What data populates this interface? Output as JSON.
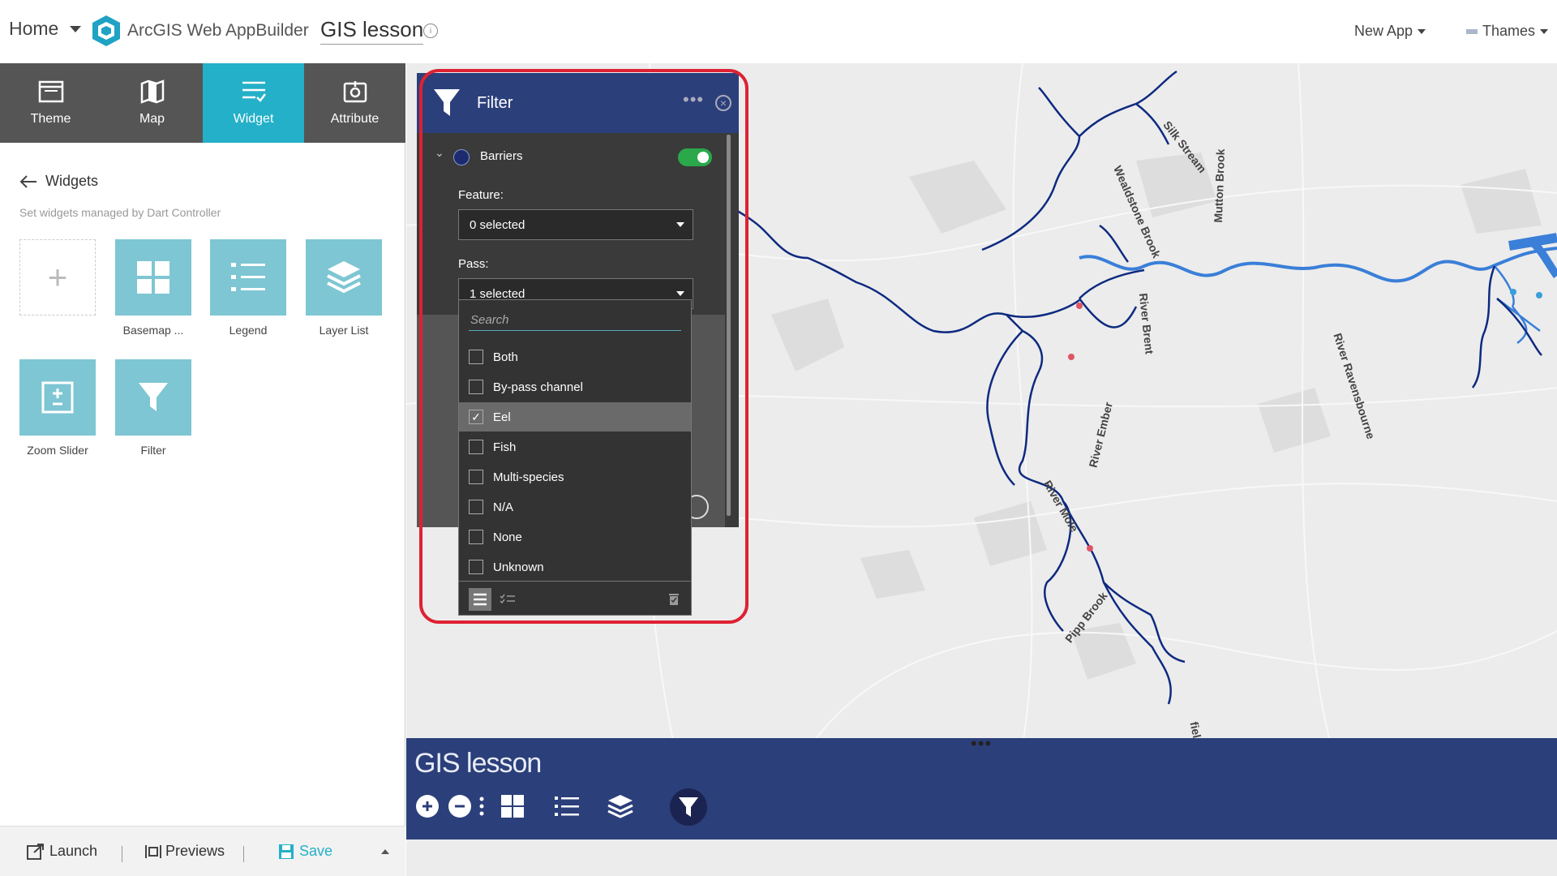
{
  "header": {
    "home": "Home",
    "brand": "ArcGIS Web AppBuilder",
    "app_name": "GIS lesson",
    "new_app": "New App",
    "theme_menu": "Thames"
  },
  "tabs": [
    {
      "label": "Theme",
      "icon": "theme-icon"
    },
    {
      "label": "Map",
      "icon": "map-icon"
    },
    {
      "label": "Widget",
      "icon": "widget-icon",
      "active": true
    },
    {
      "label": "Attribute",
      "icon": "attribute-icon"
    }
  ],
  "widgets_panel": {
    "back_label": "Widgets",
    "subtitle": "Set widgets managed by Dart Controller",
    "items": [
      {
        "label": "Basemap ...",
        "icon": "basemap-gallery-icon"
      },
      {
        "label": "Legend",
        "icon": "legend-icon"
      },
      {
        "label": "Layer List",
        "icon": "layer-list-icon"
      },
      {
        "label": "Zoom Slider",
        "icon": "zoom-slider-icon"
      },
      {
        "label": "Filter",
        "icon": "filter-icon"
      }
    ]
  },
  "footer": {
    "launch": "Launch",
    "previews": "Previews",
    "save": "Save"
  },
  "filter_panel": {
    "title": "Filter",
    "layer_name": "Barriers",
    "layer_enabled": true,
    "feature_label": "Feature:",
    "feature_value": "0 selected",
    "pass_label": "Pass:",
    "pass_value": "1 selected",
    "search_placeholder": "Search",
    "options": [
      {
        "label": "Both",
        "checked": false
      },
      {
        "label": "By-pass channel",
        "checked": false
      },
      {
        "label": "Eel",
        "checked": true
      },
      {
        "label": "Fish",
        "checked": false
      },
      {
        "label": "Multi-species",
        "checked": false
      },
      {
        "label": "N/A",
        "checked": false
      },
      {
        "label": "None",
        "checked": false
      },
      {
        "label": "Unknown",
        "checked": false
      }
    ]
  },
  "map": {
    "labels": [
      "Silk Stream",
      "Wealdstone Brook",
      "Mutton Brook",
      "River Brent",
      "River Ravensbourne",
      "River Ember",
      "River Mole",
      "Pipp Brook",
      "field-Brook"
    ]
  },
  "bottom_bar": {
    "title": "GIS lesson"
  },
  "colors": {
    "tab_bg": "#555555",
    "accent": "#24b0c8",
    "widget_tile": "#7ec6d3",
    "dark_blue": "#2b3f7a",
    "river_dark": "#0d2a80",
    "river_light": "#3a7fd8",
    "highlight": "#dd2233",
    "toggle_on": "#2aa84a"
  }
}
